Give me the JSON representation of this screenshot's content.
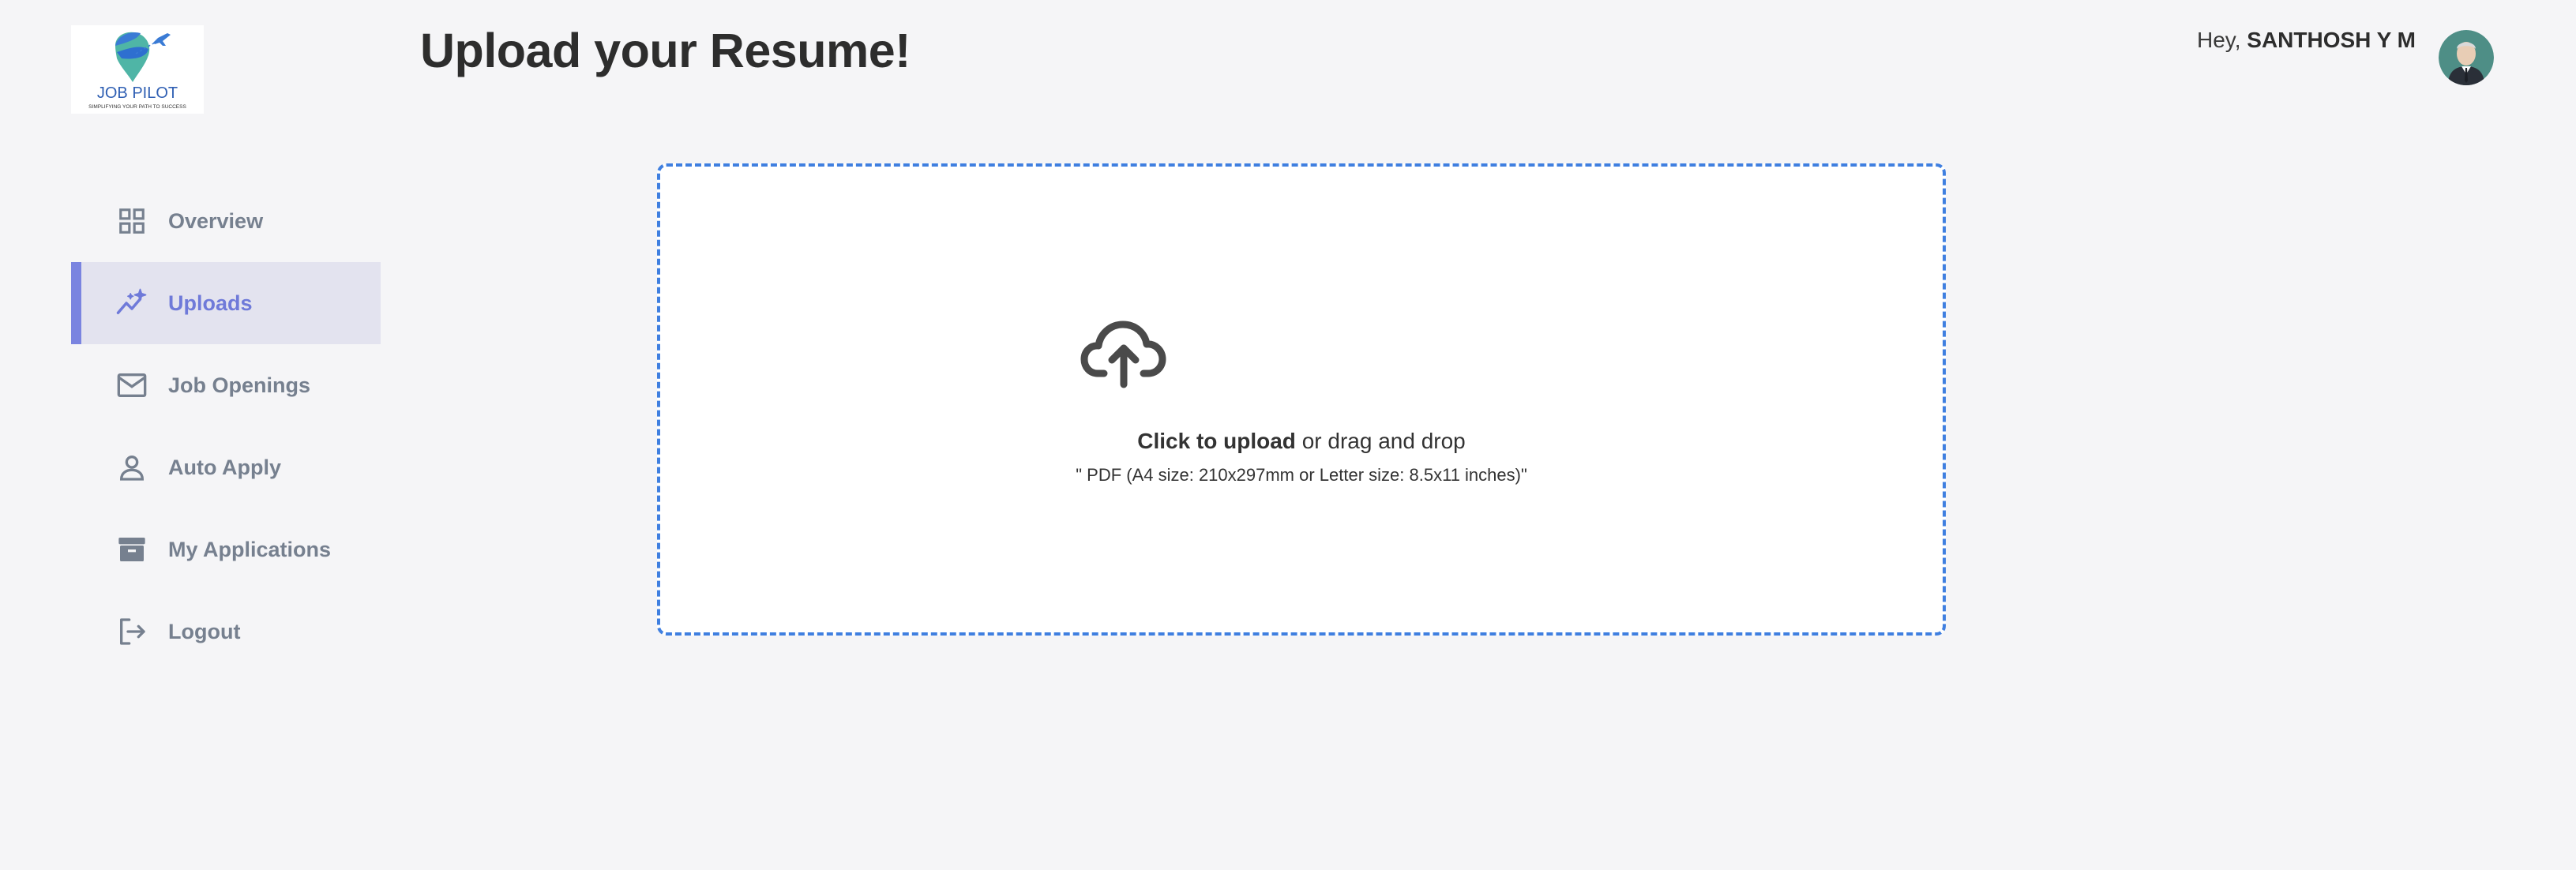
{
  "brand": {
    "name": "JOB PILOT",
    "tagline": "SIMPLIFYING YOUR PATH TO SUCCESS",
    "icon": "paper-plane-pin-logo"
  },
  "header": {
    "title": "Upload your Resume!",
    "greeting_prefix": "Hey,",
    "username": "SANTHOSH Y M"
  },
  "sidebar": {
    "items": [
      {
        "label": "Overview",
        "icon": "grid-icon",
        "active": false
      },
      {
        "label": "Uploads",
        "icon": "sparkle-trend-icon",
        "active": true
      },
      {
        "label": "Job Openings",
        "icon": "mail-icon",
        "active": false
      },
      {
        "label": "Auto Apply",
        "icon": "user-icon",
        "active": false
      },
      {
        "label": "My Applications",
        "icon": "archive-icon",
        "active": false
      },
      {
        "label": "Logout",
        "icon": "logout-icon",
        "active": false
      }
    ]
  },
  "upload": {
    "icon": "cloud-upload-icon",
    "cta": "Click to upload",
    "rest": "or drag and drop",
    "hint": "\" PDF (A4 size: 210x297mm or Letter size: 8.5x11 inches)\""
  },
  "colors": {
    "background": "#f5f5f7",
    "accent": "#7a84e0",
    "active_bg": "#e3e3ef",
    "dropzone_border": "#3f7fe0",
    "nav_text": "#76808f"
  }
}
